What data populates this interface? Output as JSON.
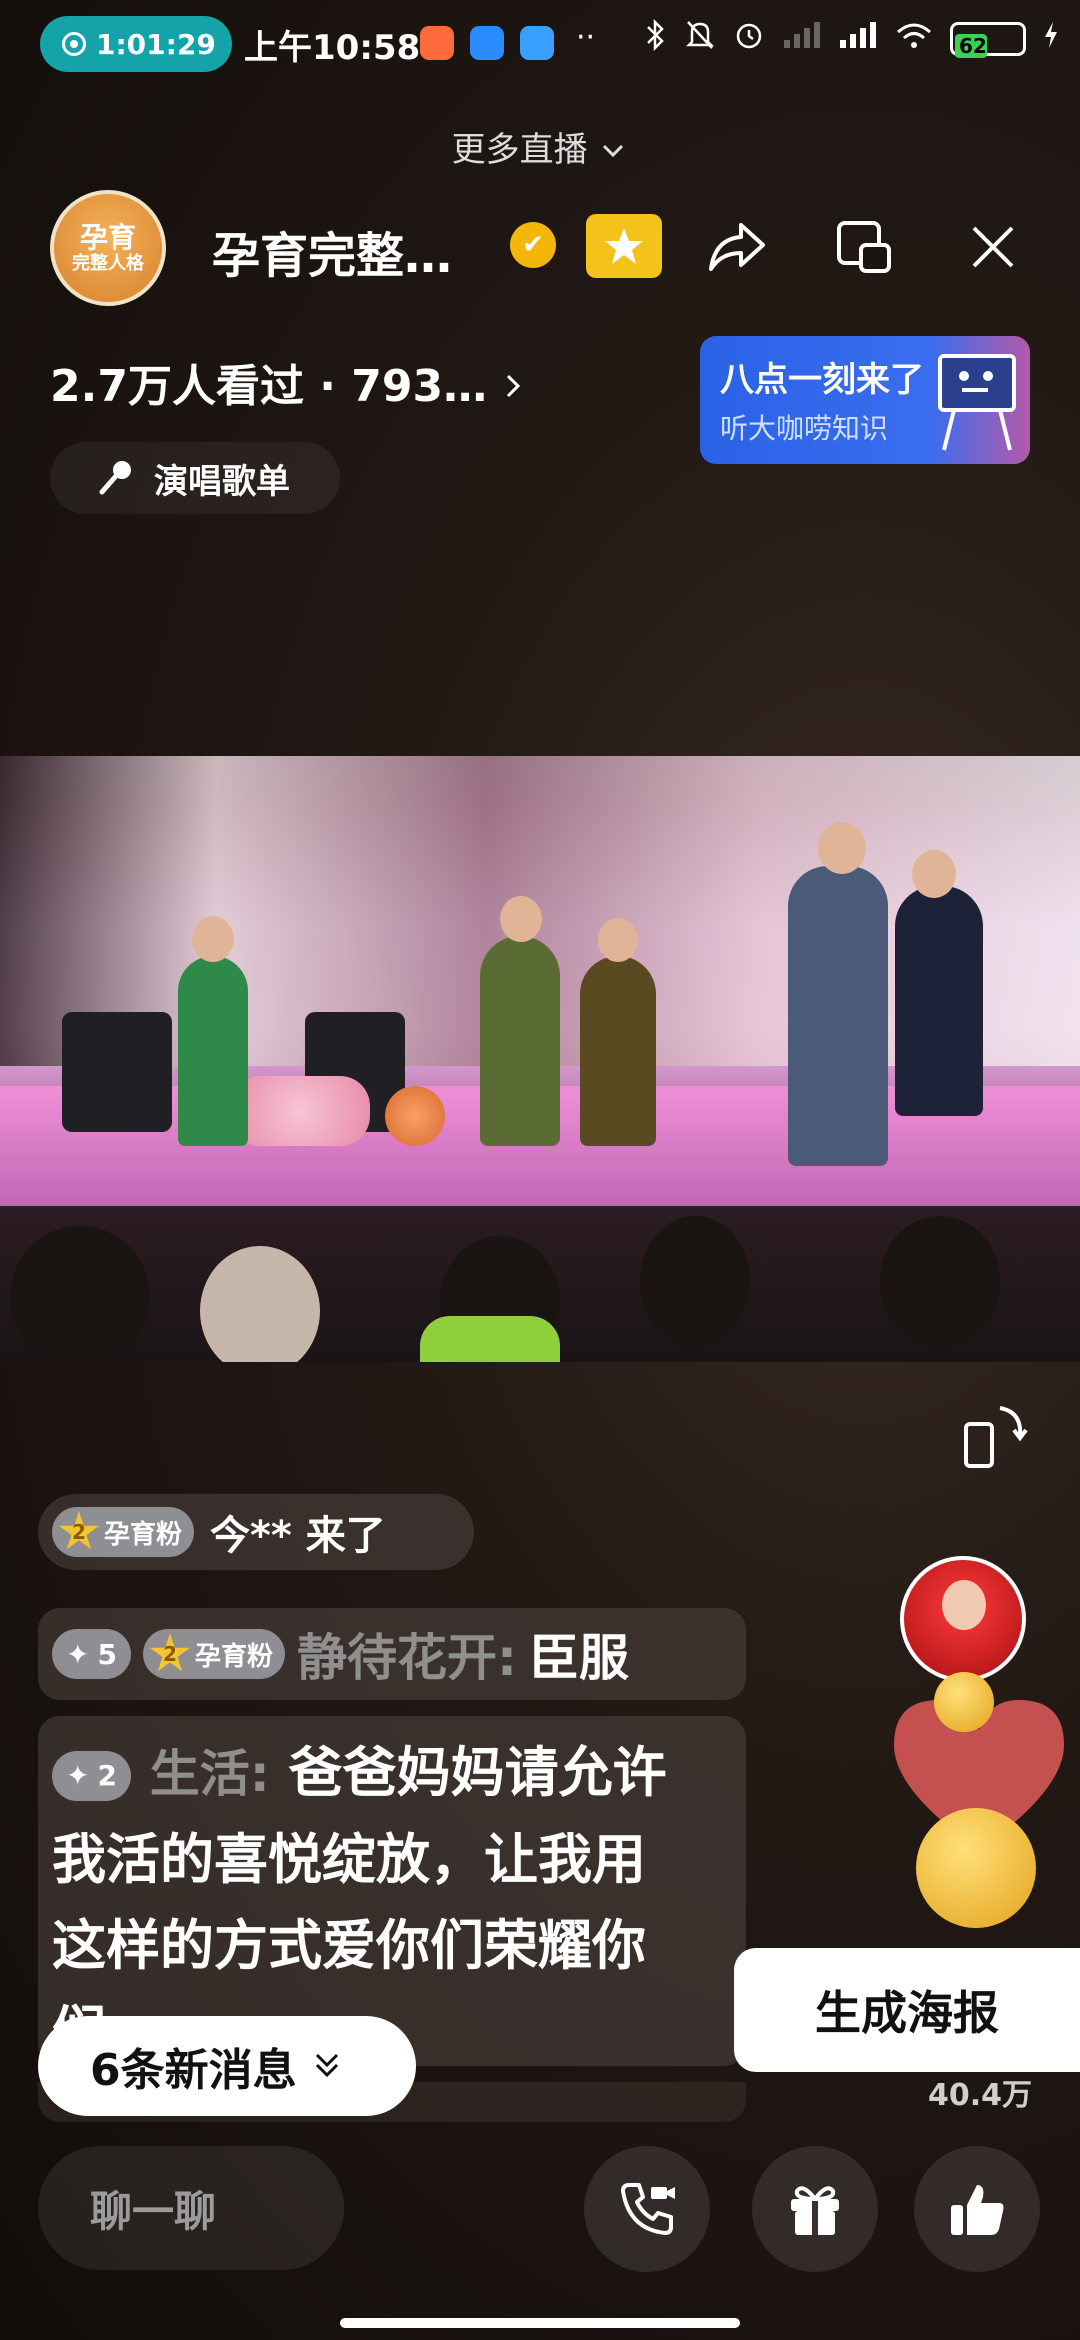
{
  "status_bar": {
    "recording_time": "1:01:29",
    "clock": "上午10:58",
    "battery": "62"
  },
  "header": {
    "more_live": "更多直播",
    "host_name": "孕育完整…",
    "avatar_text": "孕育",
    "avatar_text2": "完整人格",
    "viewers": "2.7万人看过 · 793…",
    "playlist_label": "演唱歌单"
  },
  "promo": {
    "title": "八点一刻来了",
    "subtitle": "听大咖唠知识"
  },
  "chat": {
    "join_badge_level": "2",
    "join_badge_label": "孕育粉",
    "join_text": "今** 来了",
    "message1": {
      "plus": "5",
      "badge_level": "2",
      "badge_label": "孕育粉",
      "user": "静待花开:",
      "text": "臣服"
    },
    "message2": {
      "plus": "2",
      "user": "生活:",
      "text_line1": "爸爸妈妈请允许",
      "text_line2": "我活的喜悦绽放，让我用",
      "text_line3": "这样的方式爱你们荣耀你",
      "text_line4": "们"
    },
    "new_messages": "6条新消息"
  },
  "side": {
    "poster_button": "生成海报",
    "like_count": "40.4万"
  },
  "bottom": {
    "chat_placeholder": "聊一聊"
  },
  "colors": {
    "accent_teal": "#14a3a8",
    "follow_gold": "#f3c21b",
    "verified_gold": "#f5b60a",
    "promo_blue": "#2a62e6"
  }
}
